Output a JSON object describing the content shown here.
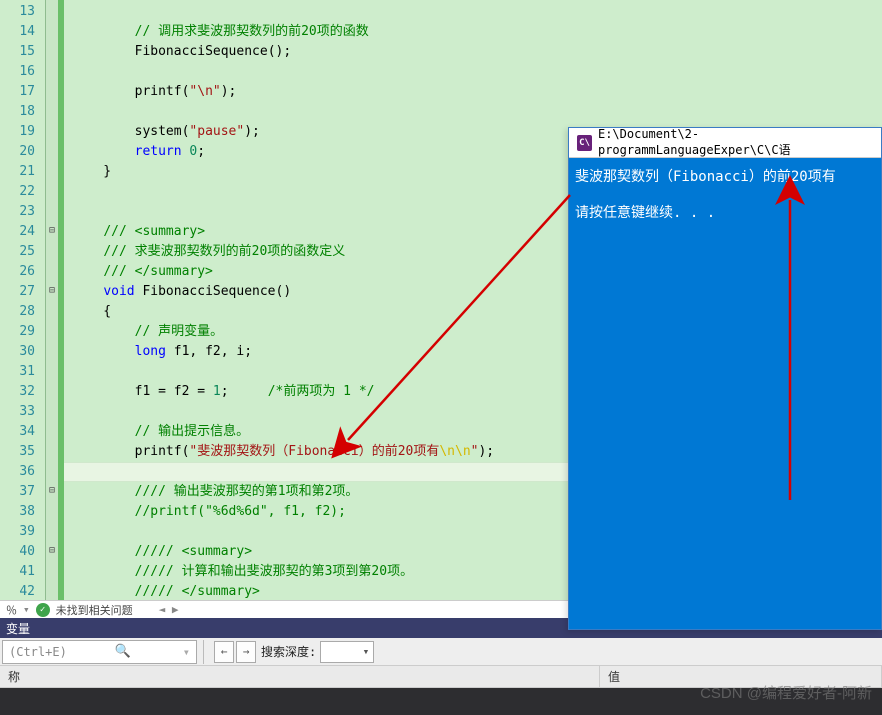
{
  "lines": {
    "start": 13,
    "end": 42
  },
  "code": {
    "l13": "",
    "l14_pre": "        ",
    "l14_c": "// 调用求斐波那契数列的前20项的函数",
    "l15_pre": "        ",
    "l15_f": "FibonacciSequence",
    "l15_post": "();",
    "l16": "",
    "l17_pre": "        ",
    "l17_f": "printf",
    "l17_p1": "(",
    "l17_s": "\"\\n\"",
    "l17_p2": ");",
    "l18": "",
    "l19_pre": "        ",
    "l19_f": "system",
    "l19_p1": "(",
    "l19_s": "\"pause\"",
    "l19_p2": ");",
    "l20_pre": "        ",
    "l20_k": "return",
    "l20_sp": " ",
    "l20_n": "0",
    "l20_p": ";",
    "l21": "    }",
    "l22": "",
    "l23": "",
    "l24_pre": "    ",
    "l24_c": "/// <summary>",
    "l25_pre": "    ",
    "l25_c": "/// 求斐波那契数列的前20项的函数定义",
    "l26_pre": "    ",
    "l26_c": "/// </summary>",
    "l27_pre": "    ",
    "l27_k": "void",
    "l27_sp": " ",
    "l27_f": "FibonacciSequence",
    "l27_p": "()",
    "l28": "    {",
    "l29_pre": "        ",
    "l29_c": "// 声明变量。",
    "l30_pre": "        ",
    "l30_t": "long",
    "l30_rest": " f1, f2, i;",
    "l31": "",
    "l32_pre": "        ",
    "l32_a": "f1 = f2 = ",
    "l32_n": "1",
    "l32_semi": ";",
    "l32_sp": "     ",
    "l32_c": "/*前两项为 1 */",
    "l33": "",
    "l34_pre": "        ",
    "l34_c": "// 输出提示信息。",
    "l35_pre": "        ",
    "l35_f": "printf",
    "l35_p1": "(",
    "l35_s1": "\"斐波那契数列（Fibonacci）的前20项有",
    "l35_e": "\\n\\n",
    "l35_s2": "\"",
    "l35_p2": ");",
    "l36": "",
    "l37_pre": "        ",
    "l37_c": "//// 输出斐波那契的第1项和第2项。",
    "l38_pre": "        ",
    "l38_c": "//printf(\"%6d%6d\", f1, f2);",
    "l39": "",
    "l40_pre": "        ",
    "l40_c": "///// <summary>",
    "l41_pre": "        ",
    "l41_c": "///// 计算和输出斐波那契的第3项到第20项。",
    "l42_pre": "        ",
    "l42_c": "///// </summary>"
  },
  "status": {
    "percent": "％",
    "no_issues": "未找到相关问题",
    "scroll_markers": "◄ ►"
  },
  "bottom": {
    "vars_label": "变量",
    "search_placeholder": "(Ctrl+E)",
    "depth_label": "搜索深度:",
    "col_name": "称",
    "col_value": "值"
  },
  "console": {
    "title": "E:\\Document\\2-programmLanguageExper\\C\\C语",
    "icon_text": "C\\",
    "line1": "斐波那契数列（Fibonacci）的前20项有",
    "line2": "请按任意键继续. . ."
  },
  "watermark": "CSDN @编程爱好者-阿新"
}
